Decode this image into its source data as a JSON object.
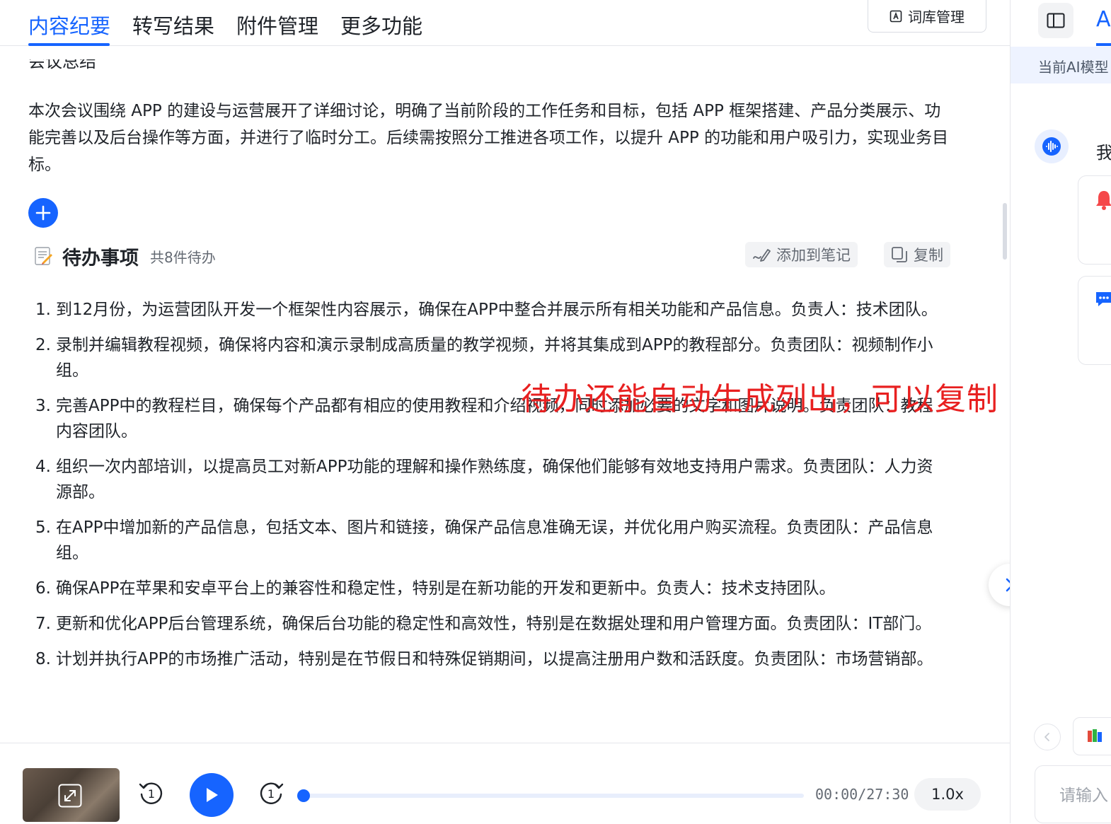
{
  "tabs": [
    {
      "label": "内容纪要",
      "active": true
    },
    {
      "label": "转写结果",
      "active": false
    },
    {
      "label": "附件管理",
      "active": false
    },
    {
      "label": "更多功能",
      "active": false
    }
  ],
  "lexicon_button": "词库管理",
  "summary": {
    "title": "会议总结",
    "body": "本次会议围绕 APP 的建设与运营展开了详细讨论，明确了当前阶段的工作任务和目标，包括 APP 框架搭建、产品分类展示、功能完善以及后台操作等方面，并进行了临时分工。后续需按照分工推进各项工作，以提升 APP 的功能和用户吸引力，实现业务目标。"
  },
  "todo": {
    "title": "待办事项",
    "count": "共8件待办",
    "add_to_notes": "添加到笔记",
    "copy": "复制",
    "items": [
      {
        "num": "1.",
        "text": "到12月份，为运营团队开发一个框架性内容展示，确保在APP中整合并展示所有相关功能和产品信息。负责人：技术团队。"
      },
      {
        "num": "2.",
        "text": "录制并编辑教程视频，确保将内容和演示录制成高质量的教学视频，并将其集成到APP的教程部分。负责团队：视频制作小组。"
      },
      {
        "num": "3.",
        "text": "完善APP中的教程栏目，确保每个产品都有相应的使用教程和介绍视频，同时添加必要的文字和图片说明。负责团队：教程内容团队。"
      },
      {
        "num": "4.",
        "text": "组织一次内部培训，以提高员工对新APP功能的理解和操作熟练度，确保他们能够有效地支持用户需求。负责团队：人力资源部。"
      },
      {
        "num": "5.",
        "text": "在APP中增加新的产品信息，包括文本、图片和链接，确保产品信息准确无误，并优化用户购买流程。负责团队：产品信息组。"
      },
      {
        "num": "6.",
        "text": "确保APP在苹果和安卓平台上的兼容性和稳定性，特别是在新功能的开发和更新中。负责人：技术支持团队。"
      },
      {
        "num": "7.",
        "text": "更新和优化APP后台管理系统，确保后台功能的稳定性和高效性，特别是在数据处理和用户管理方面。负责团队：IT部门。"
      },
      {
        "num": "8.",
        "text": "计划并执行APP的市场推广活动，特别是在节假日和特殊促销期间，以提高注册用户数和活跃度。负责团队：市场营销部。"
      }
    ]
  },
  "annotation": "待办还能自动生成列出，可以复制",
  "player": {
    "time": "00:00/27:30",
    "speed": "1.0x",
    "progress": 0
  },
  "side": {
    "tab_label": "A",
    "model_label": "当前AI模型",
    "greeting": "我",
    "input_placeholder": "请输入"
  },
  "colors": {
    "accent": "#1664ff",
    "annotation": "#e82020"
  }
}
